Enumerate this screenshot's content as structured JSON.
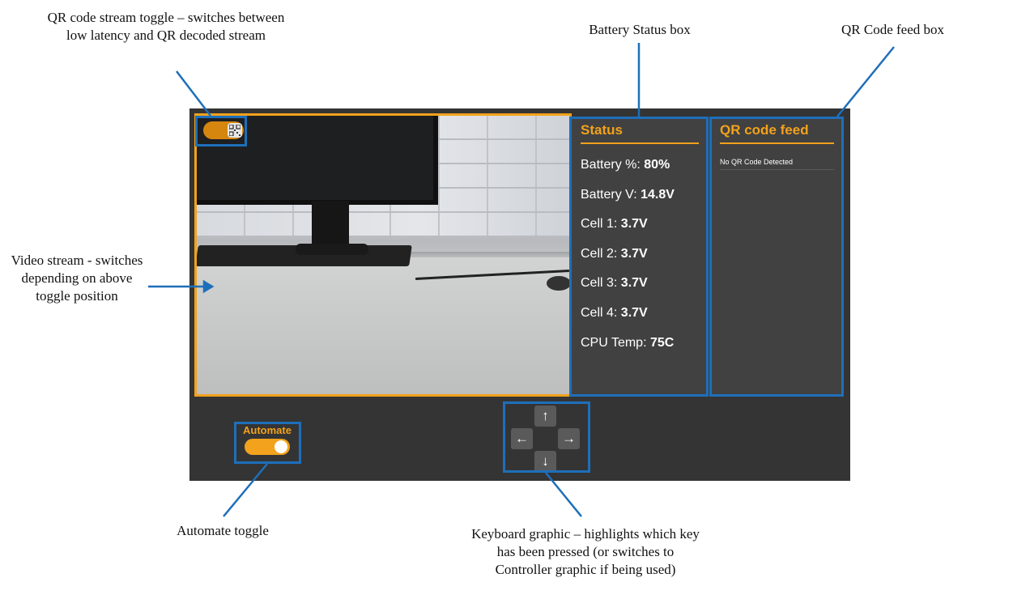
{
  "annotations": {
    "qr_toggle": "QR code stream toggle – switches between low latency and QR decoded stream",
    "battery_box": "Battery Status box",
    "qr_feed_box": "QR Code feed box",
    "video_stream": "Video stream - switches depending on above toggle position",
    "automate_toggle": "Automate toggle",
    "keyboard_graphic": "Keyboard graphic – highlights which key has been pressed (or switches to Controller graphic if being used)"
  },
  "colors": {
    "accent": "#f2a21c",
    "panel": "#343434",
    "box": "#414141",
    "highlight": "#1e6fba"
  },
  "video": {
    "qr_toggle_icon": "qr-code-icon",
    "qr_toggle_on": true
  },
  "status": {
    "title": "Status",
    "rows": [
      {
        "label": "Battery %: ",
        "value": "80%"
      },
      {
        "label": "Battery V: ",
        "value": "14.8V"
      },
      {
        "label": "Cell 1: ",
        "value": "3.7V"
      },
      {
        "label": "Cell 2: ",
        "value": "3.7V"
      },
      {
        "label": "Cell 3: ",
        "value": "3.7V"
      },
      {
        "label": "Cell 4: ",
        "value": "3.7V"
      },
      {
        "label": "CPU Temp: ",
        "value": "75C"
      }
    ]
  },
  "qr_feed": {
    "title": "QR code feed",
    "entries": [
      "No QR Code Detected"
    ]
  },
  "automate": {
    "label": "Automate",
    "on": true
  },
  "keys": {
    "up": "↑",
    "left": "←",
    "right": "→",
    "down": "↓"
  }
}
